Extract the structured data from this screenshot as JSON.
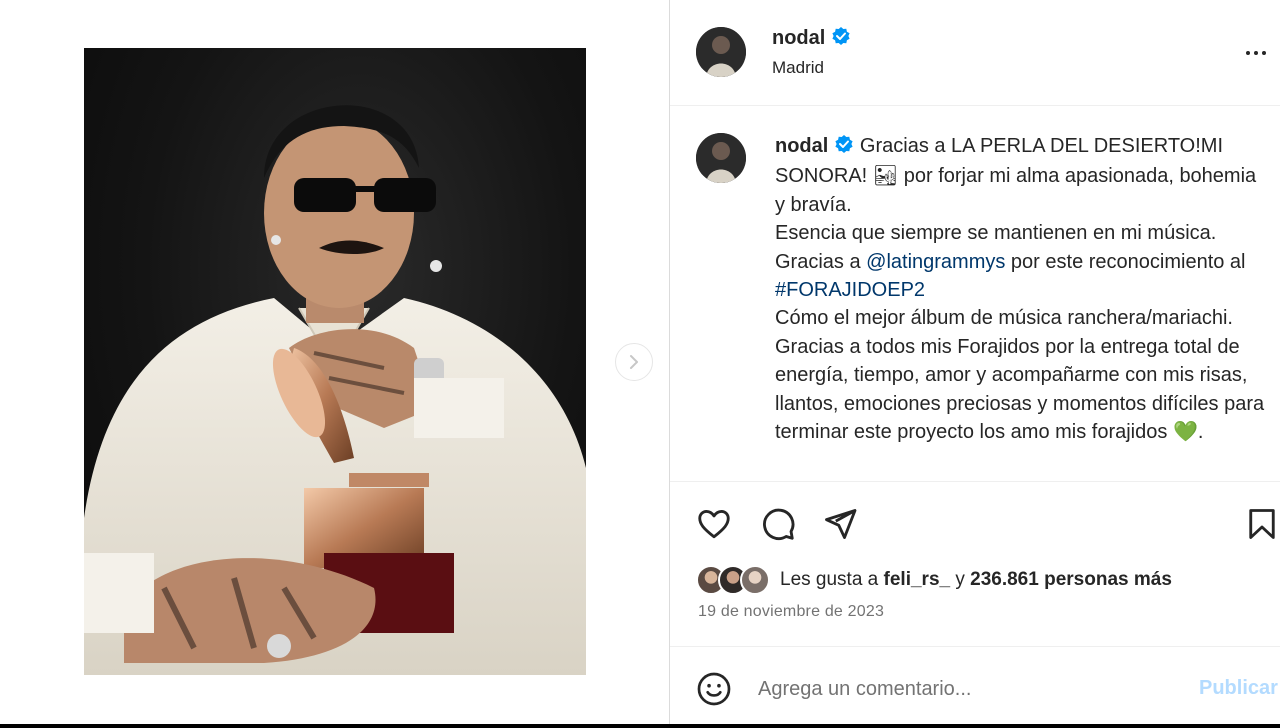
{
  "post": {
    "username": "nodal",
    "location": "Madrid",
    "caption": {
      "line1": "Gracias a LA PERLA DEL DESIERTO!MI SONORA! ",
      "line1_emoji": "🏜",
      "line1_rest": " por forjar mi alma apasionada, bohemia y bravía.",
      "line2": "Esencia que siempre se mantienen en mi música.",
      "line3_pre": "Gracias a ",
      "mention": "@latingrammys",
      "line3_post": " por este reconocimiento al ",
      "hashtag": "#FORAJIDOEP2",
      "line4": "Cómo el mejor álbum de música ranchera/mariachi. Gracias a todos mis Forajidos por la entrega total de energía, tiempo, amor y acompañarme con mis risas, llantos, emociones preciosas y momentos difíciles para terminar este proyecto los amo mis forajidos ",
      "line4_emoji": "💚",
      "line4_end": "."
    },
    "likes": {
      "prefix": "Les gusta a ",
      "user": "feli_rs_",
      "connector": " y ",
      "count": "236.861 personas más"
    },
    "date": "19 de noviembre de 2023"
  },
  "comment": {
    "placeholder": "Agrega un comentario...",
    "publish_label": "Publicar"
  },
  "colors": {
    "verified": "#0095f6",
    "link": "#00376b",
    "publish_disabled": "#b3dbff",
    "muted": "#737373"
  },
  "icons": {
    "verified": "verified-badge-icon",
    "more": "more-options-icon",
    "like": "heart-icon",
    "comment": "comment-bubble-icon",
    "share": "paper-plane-icon",
    "save": "bookmark-icon",
    "emoji": "smiley-icon",
    "next": "chevron-right-icon"
  }
}
